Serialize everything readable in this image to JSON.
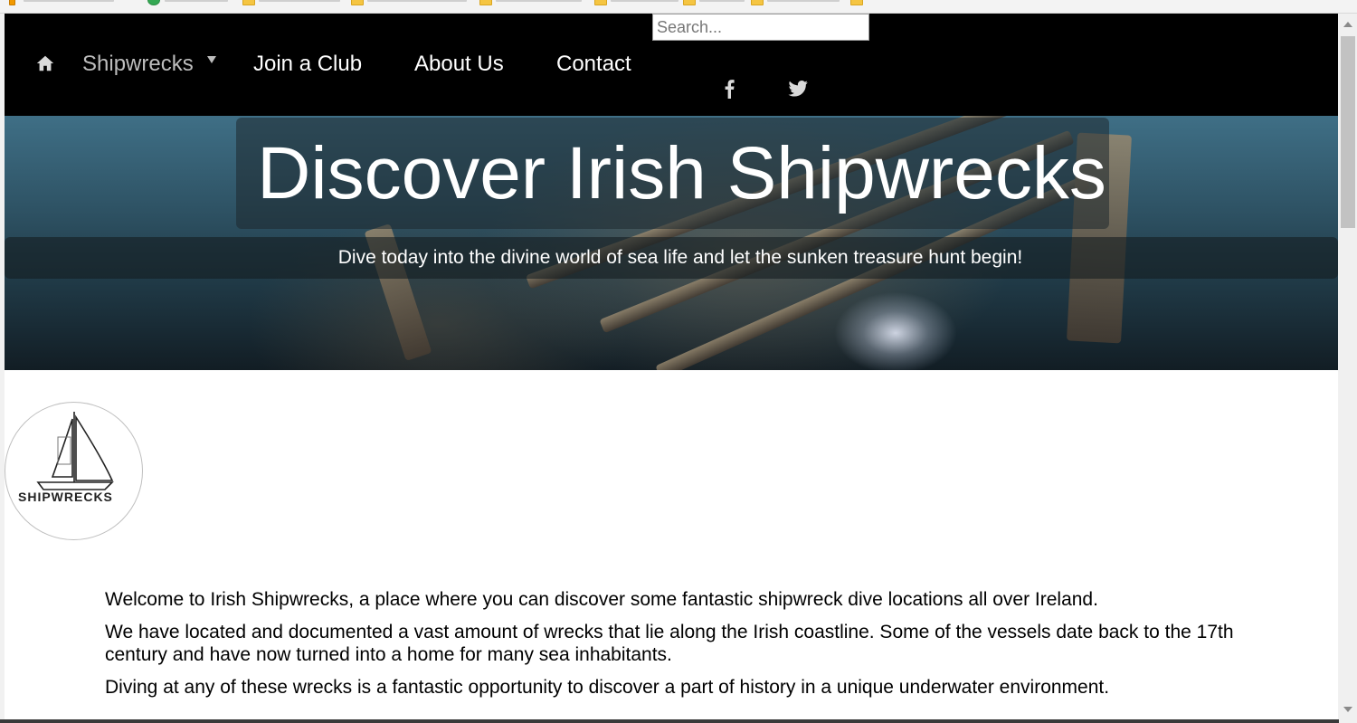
{
  "nav": {
    "home_icon": "home-icon",
    "items": [
      {
        "label": "Shipwrecks",
        "has_dropdown": true,
        "active": true
      },
      {
        "label": "Join a Club"
      },
      {
        "label": "About Us"
      },
      {
        "label": "Contact"
      }
    ],
    "search_placeholder": "Search...",
    "social": [
      "facebook-icon",
      "twitter-icon"
    ]
  },
  "hero": {
    "title": "Discover Irish Shipwrecks",
    "subtitle": "Dive today into the divine world of sea life and let the sunken treasure hunt begin!"
  },
  "logo": {
    "text": "SHIPWRECKS"
  },
  "content": {
    "paragraphs": [
      "Welcome to Irish Shipwrecks, a place where you can discover some fantastic shipwreck dive locations all over Ireland.",
      "We have located and documented a vast amount of wrecks that lie along the Irish coastline. Some of the vessels date back to the 17th century and have now turned into a home for many sea inhabitants.",
      "Diving at any of these wrecks is a fantastic opportunity to discover a part of history in a unique underwater environment."
    ]
  },
  "colors": {
    "nav_bg": "#000000",
    "nav_text": "#ffffff",
    "nav_active": "#bdbdbd"
  }
}
